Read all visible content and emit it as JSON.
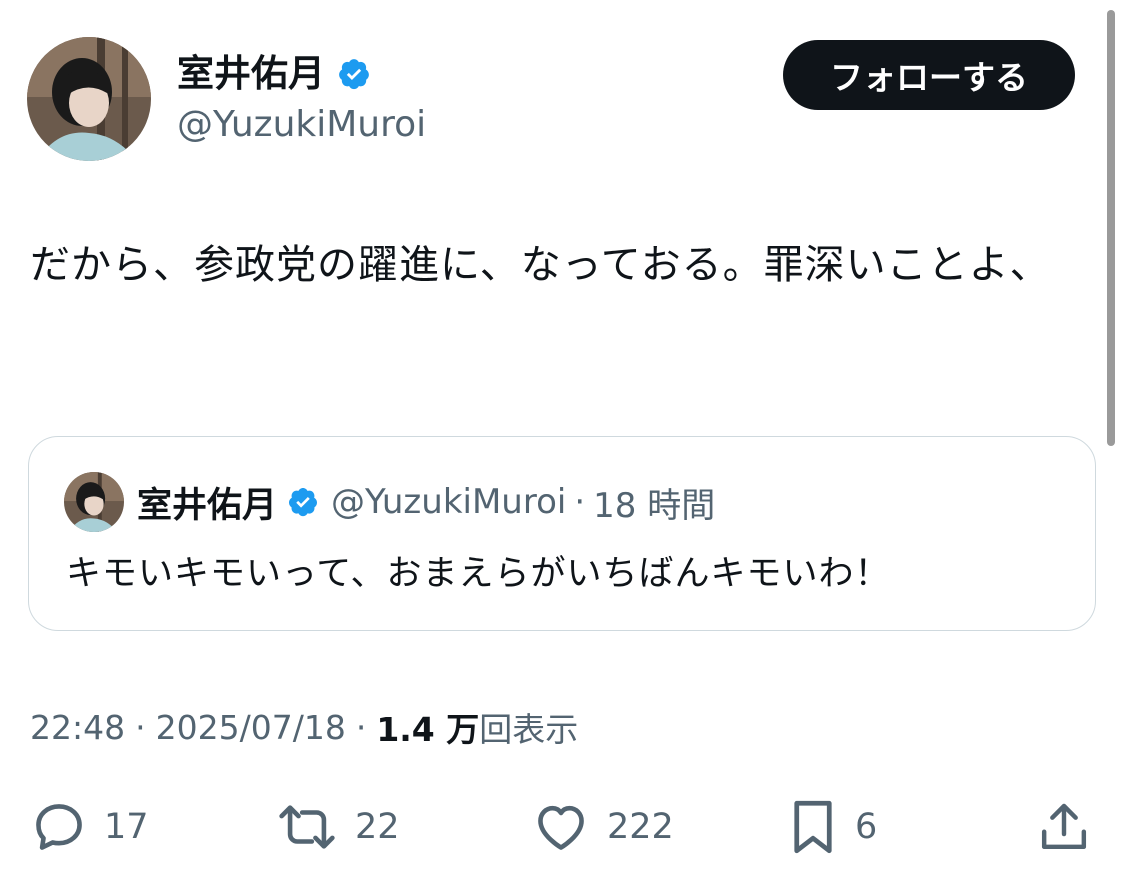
{
  "author": {
    "name": "室井佑月",
    "handle": "@YuzukiMuroi",
    "verified": true
  },
  "follow_button": "フォローする",
  "tweet": {
    "text": "だから、参政党の躍進に、なっておる。罪深いことよ、"
  },
  "quoted_tweet": {
    "name": "室井佑月",
    "handle": "@YuzukiMuroi",
    "separator": "·",
    "time": "18 時間",
    "text": "キモいキモいって、おまえらがいちばんキモいわ！"
  },
  "meta": {
    "time": "22:48",
    "separator": "·",
    "date": "2025/07/18",
    "views_count": "1.4 万",
    "views_label": "回表示"
  },
  "actions": {
    "reply_count": "17",
    "retweet_count": "22",
    "like_count": "222",
    "bookmark_count": "6"
  },
  "colors": {
    "verified_badge": "#1d9bf0",
    "text_primary": "#0f1419",
    "text_secondary": "#536471",
    "border": "#cfd9de",
    "follow_bg": "#0f1419"
  },
  "icons": {
    "reply": "speech-bubble-icon",
    "retweet": "retweet-arrows-icon",
    "like": "heart-icon",
    "bookmark": "bookmark-icon",
    "share": "share-upload-icon",
    "verified": "verified-badge-icon"
  }
}
